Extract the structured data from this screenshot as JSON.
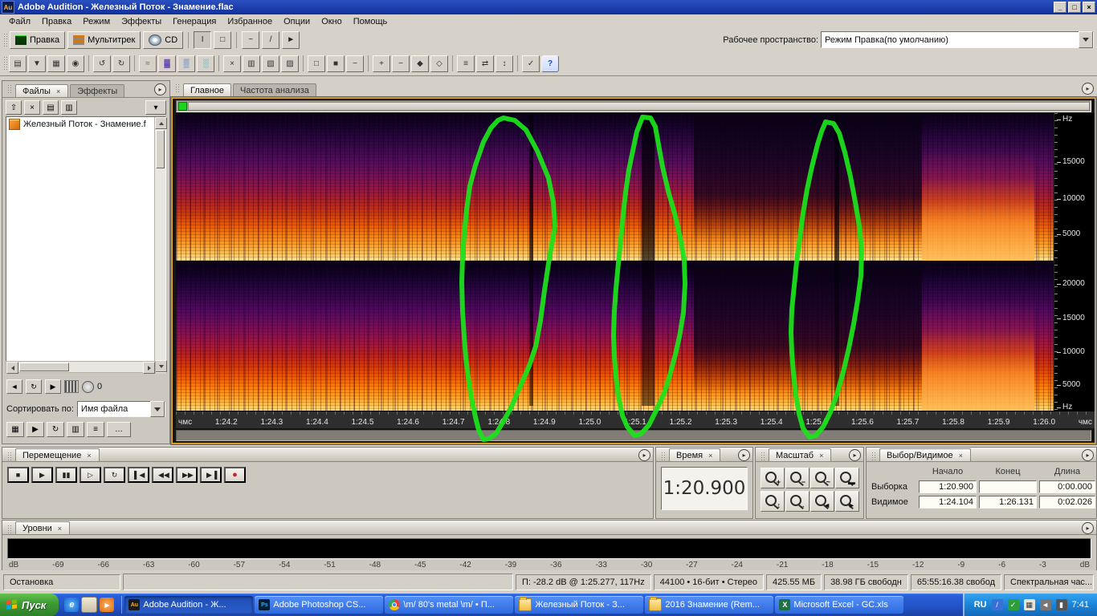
{
  "ui": {
    "close_glyph": "×"
  },
  "window": {
    "title": "Adobe Audition - Железный Поток - Знамение.flac",
    "app_icon": "Au",
    "controls": [
      "_",
      "□",
      "×"
    ]
  },
  "menu_bar": {
    "items": [
      "Файл",
      "Правка",
      "Режим",
      "Эффекты",
      "Генерация",
      "Избранное",
      "Опции",
      "Окно",
      "Помощь"
    ]
  },
  "toolbar_top": {
    "edit_view": "Правка",
    "multitrack_view": "Мультитрек",
    "cd_view": "CD",
    "workspace_label": "Рабочее пространство:",
    "workspace_value": "Режим Правка(по умолчанию)",
    "tools": [
      {
        "n": "time-selection-tool",
        "g": "I"
      },
      {
        "n": "marquee-selection-tool",
        "g": "□"
      },
      {
        "n": "lasso-selection-tool",
        "g": "~"
      },
      {
        "n": "effects-paintbrush-tool",
        "g": "/"
      },
      {
        "n": "scrub-tool",
        "g": "►"
      }
    ]
  },
  "toolbar2": {
    "icons": [
      {
        "n": "open",
        "g": "▤"
      },
      {
        "n": "save",
        "g": "▼"
      },
      {
        "n": "batch-process",
        "g": "▦"
      },
      {
        "n": "extract-audio-cd",
        "g": "◉"
      },
      {
        "n": "undo",
        "g": "↺"
      },
      {
        "n": "redo",
        "g": "↻"
      },
      {
        "n": "waveform-view",
        "g": "≈"
      },
      {
        "n": "spectral-frequency-view",
        "g": "▓"
      },
      {
        "n": "spectral-pan-view",
        "g": "▒"
      },
      {
        "n": "spectral-phase-view",
        "g": "░"
      },
      {
        "n": "cut",
        "g": "×"
      },
      {
        "n": "copy",
        "g": "▥"
      },
      {
        "n": "paste",
        "g": "▧"
      },
      {
        "n": "mix-paste",
        "g": "▨"
      },
      {
        "n": "crop",
        "g": "□"
      },
      {
        "n": "trim",
        "g": "■"
      },
      {
        "n": "delete-selection",
        "g": "−"
      },
      {
        "n": "zoom-in",
        "g": "+"
      },
      {
        "n": "zoom-out",
        "g": "−"
      },
      {
        "n": "zoom-to-selection",
        "g": "◆"
      },
      {
        "n": "zoom-full",
        "g": "◇"
      },
      {
        "n": "snapping",
        "g": "≡"
      },
      {
        "n": "convert-sample-type",
        "g": "⇄"
      },
      {
        "n": "normalize",
        "g": "↕"
      },
      {
        "n": "scripts",
        "g": "✓"
      },
      {
        "n": "help",
        "g": "?"
      }
    ]
  },
  "files_panel": {
    "tab_files": "Файлы",
    "tab_effects": "Эффекты",
    "toolbar": [
      {
        "n": "import-file",
        "g": "⇧"
      },
      {
        "n": "close-file",
        "g": "×"
      },
      {
        "n": "insert-into-multitrack",
        "g": "▤"
      },
      {
        "n": "insert-into-cd",
        "g": "▥"
      },
      {
        "n": "options",
        "g": "▾"
      }
    ],
    "file_name": "Железный Поток - Знамение.f",
    "transport": {
      "mute": "◄",
      "loop": "↻",
      "play": "▶",
      "count": "0"
    },
    "sort_label": "Сортировать по:",
    "sort_value": "Имя файла",
    "bottom_icons": [
      {
        "n": "show-file-types",
        "g": "▦"
      },
      {
        "n": "auto-play",
        "g": "▶"
      },
      {
        "n": "loop-playback",
        "g": "↻"
      },
      {
        "n": "follow-session",
        "g": "▥"
      },
      {
        "n": "show-markers",
        "g": "≡"
      },
      {
        "n": "advanced-options",
        "g": "…"
      }
    ]
  },
  "main_view": {
    "tab_main": "Главное",
    "tab_freq": "Частота анализа",
    "freq_labels_top": [
      "Hz",
      "15000",
      "10000",
      "5000"
    ],
    "freq_labels_bottom": [
      "20000",
      "15000",
      "10000",
      "5000",
      "Hz"
    ],
    "time_ruler": [
      "чмс",
      "1:24.2",
      "1:24.3",
      "1:24.4",
      "1:24.5",
      "1:24.6",
      "1:24.7",
      "1:24.8",
      "1:24.9",
      "1:25.0",
      "1:25.1",
      "1:25.2",
      "1:25.3",
      "1:25.4",
      "1:25.5",
      "1:25.6",
      "1:25.7",
      "1:25.8",
      "1:25.9",
      "1:26.0",
      "чмс"
    ]
  },
  "transport_panel": {
    "title": "Перемещение",
    "buttons": [
      {
        "n": "stop",
        "g": "■"
      },
      {
        "n": "play",
        "g": "▶"
      },
      {
        "n": "pause",
        "g": "▮▮"
      },
      {
        "n": "play-from-cursor",
        "g": "▷"
      },
      {
        "n": "play-looped",
        "g": "↻"
      },
      {
        "n": "go-to-beginning",
        "g": "▌◀"
      },
      {
        "n": "rewind",
        "g": "◀◀"
      },
      {
        "n": "fast-forward",
        "g": "▶▶"
      },
      {
        "n": "go-to-end",
        "g": "▶▐"
      },
      {
        "n": "record",
        "g": "●"
      }
    ]
  },
  "time_panel": {
    "title": "Время",
    "value": "1:20.900"
  },
  "zoom_panel": {
    "title": "Масштаб",
    "icons": [
      {
        "n": "zoom-in-horizontal",
        "g": "+"
      },
      {
        "n": "zoom-out-horizontal",
        "g": "−"
      },
      {
        "n": "zoom-to-selection",
        "g": "~"
      },
      {
        "n": "zoom-full",
        "g": "▬"
      },
      {
        "n": "zoom-in-vertical",
        "g": "↕"
      },
      {
        "n": "zoom-out-vertical",
        "g": "↔"
      },
      {
        "n": "zoom-left-edge",
        "g": "◄"
      },
      {
        "n": "zoom-right-edge",
        "g": "►"
      }
    ]
  },
  "selection_panel": {
    "title": "Выбор/Видимое",
    "col_start": "Начало",
    "col_end": "Конец",
    "col_length": "Длина",
    "row_selection": "Выборка",
    "row_view": "Видимое",
    "selection_start": "1:20.900",
    "selection_end": "",
    "selection_length": "0:00.000",
    "view_start": "1:24.104",
    "view_end": "1:26.131",
    "view_length": "0:02.026"
  },
  "levels_panel": {
    "title": "Уровни",
    "db_label": "dB",
    "scale": [
      "-69",
      "-66",
      "-63",
      "-60",
      "-57",
      "-54",
      "-51",
      "-48",
      "-45",
      "-42",
      "-39",
      "-36",
      "-33",
      "-30",
      "-27",
      "-24",
      "-21",
      "-18",
      "-15",
      "-12",
      "-9",
      "-6",
      "-3"
    ]
  },
  "status_bar": {
    "state": "Остановка",
    "cursor_info": "П: -28.2 dB @ 1:25.277, 117Hz",
    "format_info": "44100 • 16-бит • Стерео",
    "file_size": "425.55 МБ",
    "disk_free": "38.98 ГБ свободн",
    "time_free": "65:55:16.38 свобод",
    "view_mode": "Спектральная час..."
  },
  "taskbar": {
    "start": "Пуск",
    "quick": [
      {
        "n": "internet-explorer",
        "g": "e"
      },
      {
        "n": "show-desktop",
        "g": ""
      },
      {
        "n": "media-player",
        "g": "▶"
      }
    ],
    "tasks": [
      {
        "label": "Adobe Audition - Ж...",
        "icon_text": "Au"
      },
      {
        "label": "Adobe Photoshop CS...",
        "icon_text": "Ps"
      },
      {
        "label": "\\m/ 80's metal \\m/ • П...",
        "icon_text": ""
      },
      {
        "label": "Железный Поток - З...",
        "icon_text": ""
      },
      {
        "label": "2016 Знамение (Rem...",
        "icon_text": ""
      },
      {
        "label": "Microsoft Excel - GC.xls",
        "icon_text": "X"
      }
    ],
    "language": "RU",
    "tray_icons": [
      {
        "n": "pen-input",
        "g": "/"
      },
      {
        "n": "antivirus",
        "g": "✓"
      },
      {
        "n": "scheduler",
        "g": "▦"
      },
      {
        "n": "volume",
        "g": "◄"
      },
      {
        "n": "network",
        "g": "▮"
      }
    ],
    "clock": "7:41"
  }
}
